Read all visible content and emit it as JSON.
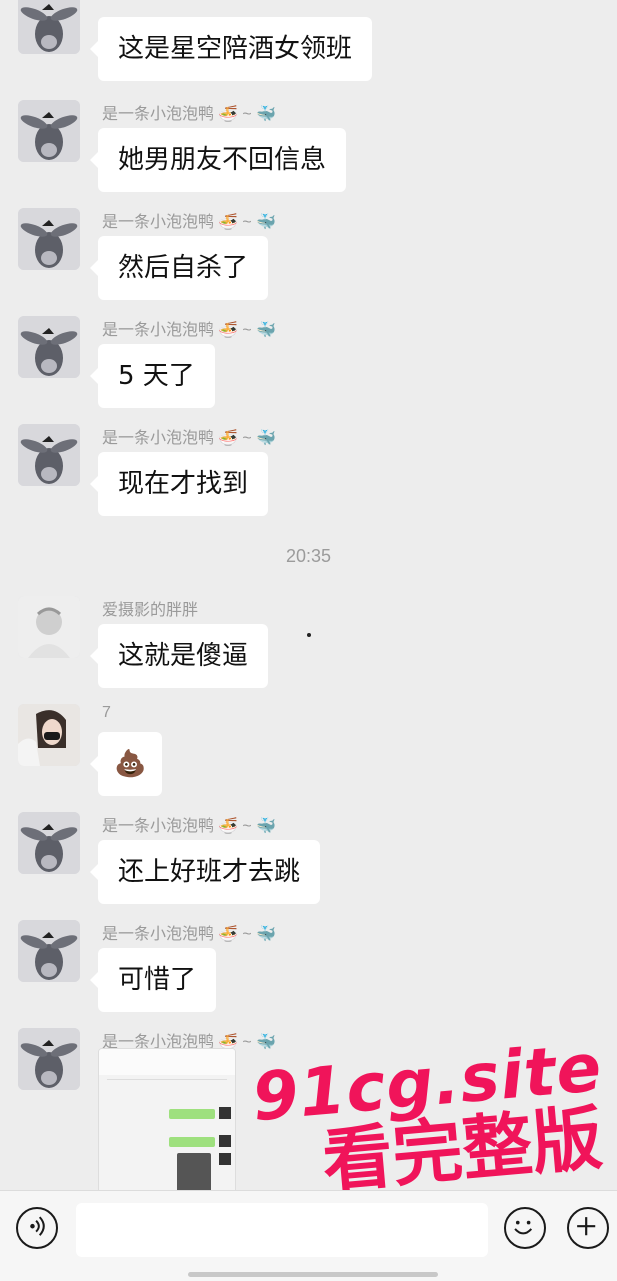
{
  "messages": [
    {
      "sender": "",
      "text": "这是星空陪酒女领班",
      "avatar": "donkey-avatar"
    },
    {
      "sender": "是一条小泡泡鸭",
      "sender_deco": "~",
      "text": "她男朋友不回信息",
      "avatar": "donkey-avatar"
    },
    {
      "sender": "是一条小泡泡鸭",
      "sender_deco": "~",
      "text": "然后自杀了",
      "avatar": "donkey-avatar"
    },
    {
      "sender": "是一条小泡泡鸭",
      "sender_deco": "~",
      "text": "5 天了",
      "avatar": "donkey-avatar"
    },
    {
      "sender": "是一条小泡泡鸭",
      "sender_deco": "~",
      "text": "现在才找到",
      "avatar": "donkey-avatar"
    },
    {
      "sender": "爱摄影的胖胖",
      "text": "这就是傻逼",
      "avatar": "photo-avatar"
    },
    {
      "sender": "7",
      "text": "💩",
      "avatar": "girl-avatar"
    },
    {
      "sender": "是一条小泡泡鸭",
      "sender_deco": "~",
      "text": "还上好班才去跳",
      "avatar": "donkey-avatar"
    },
    {
      "sender": "是一条小泡泡鸭",
      "sender_deco": "~",
      "text": "可惜了",
      "avatar": "donkey-avatar"
    },
    {
      "sender": "是一条小泡泡鸭",
      "sender_deco": "~",
      "text": "",
      "avatar": "donkey-avatar",
      "attachment": "screenshot-image"
    }
  ],
  "timestamp": "20:35",
  "watermark": {
    "line1": "91cg.site",
    "line2": "看完整版"
  },
  "input_bar": {
    "voice_icon": "voice-icon",
    "emoji_icon": "emoji-icon",
    "plus_icon": "plus-icon"
  },
  "colors": {
    "background": "#ededed",
    "bubble": "#ffffff",
    "watermark": "#f0145a",
    "sender": "#9a9a9a"
  }
}
